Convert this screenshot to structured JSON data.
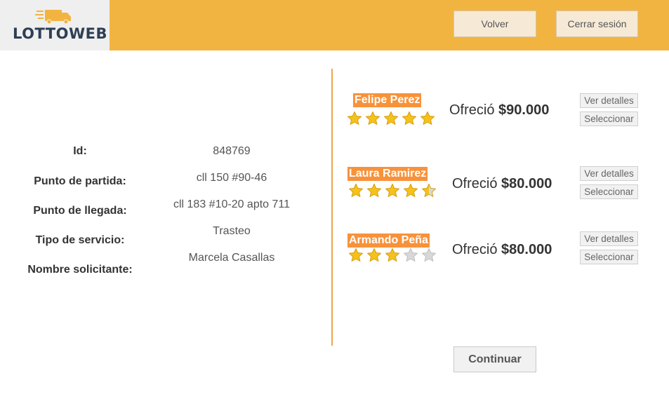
{
  "header": {
    "logo_text": "LOTTOWEB",
    "back_label": "Volver",
    "logout_label": "Cerrar sesión"
  },
  "request": {
    "fields": [
      {
        "label": "Id:",
        "value": "848769"
      },
      {
        "label": "Punto de partida:",
        "value": "cll 150 #90-46"
      },
      {
        "label": "Punto de llegada:",
        "value": "cll 183 #10-20 apto 711"
      },
      {
        "label": "Tipo de servicio:",
        "value": "Trasteo"
      },
      {
        "label": "Nombre solicitante:",
        "value": "Marcela Casallas"
      }
    ]
  },
  "offers": [
    {
      "name": "Felipe Perez",
      "rating": 5,
      "rating_max": 5,
      "offer_prefix": "Ofreció",
      "amount": "$90.000",
      "details_label": "Ver detalles",
      "select_label": "Seleccionar"
    },
    {
      "name": "Laura Ramirez",
      "rating": 4.5,
      "rating_max": 5,
      "offer_prefix": "Ofreció",
      "amount": "$80.000",
      "details_label": "Ver detalles",
      "select_label": "Seleccionar"
    },
    {
      "name": "Armando Peña",
      "rating": 3,
      "rating_max": 5,
      "offer_prefix": "Ofreció",
      "amount": "$80.000",
      "details_label": "Ver detalles",
      "select_label": "Seleccionar"
    }
  ],
  "footer": {
    "continue_label": "Continuar"
  },
  "colors": {
    "header_bg": "#f2b441",
    "name_badge": "#f7923a",
    "divider": "#f0a54a",
    "star_fill": "#f4c21a",
    "star_empty": "#d8d8d8"
  },
  "icons": {
    "logo": "delivery-truck-icon",
    "rating": "star-icon"
  }
}
